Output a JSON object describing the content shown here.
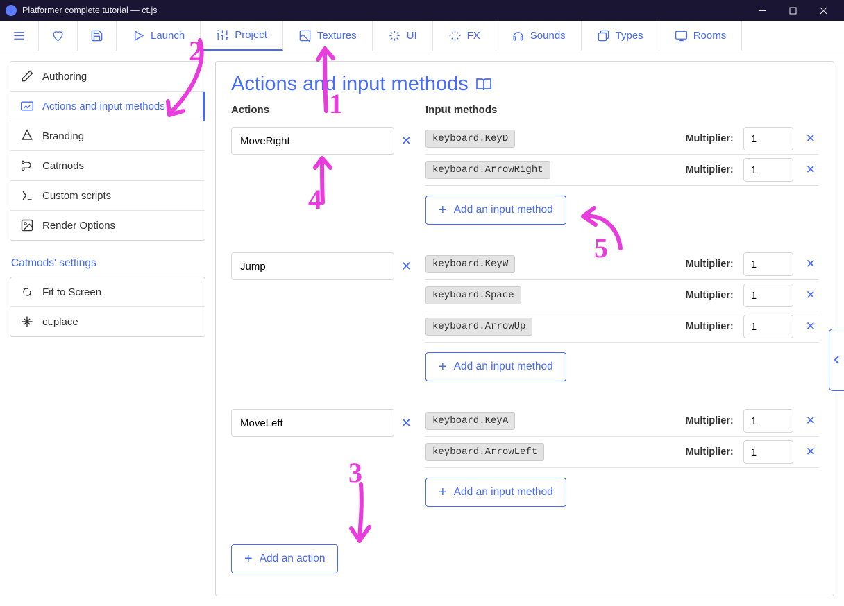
{
  "window": {
    "title": "Platformer complete tutorial — ct.js"
  },
  "toolbar": {
    "launch": "Launch",
    "project": "Project",
    "textures": "Textures",
    "ui": "UI",
    "fx": "FX",
    "sounds": "Sounds",
    "types": "Types",
    "rooms": "Rooms"
  },
  "sidebar": {
    "items": [
      {
        "label": "Authoring"
      },
      {
        "label": "Actions and input methods"
      },
      {
        "label": "Branding"
      },
      {
        "label": "Catmods"
      },
      {
        "label": "Custom scripts"
      },
      {
        "label": "Render Options"
      }
    ],
    "catmods_heading": "Catmods' settings",
    "catmods_items": [
      {
        "label": "Fit to Screen"
      },
      {
        "label": "ct.place"
      }
    ]
  },
  "panel": {
    "heading": "Actions and input methods",
    "col_actions": "Actions",
    "col_inputs": "Input methods",
    "multiplier_label": "Multiplier:",
    "add_input_label": "Add an input method",
    "add_action_label": "Add an action",
    "actions": [
      {
        "name": "MoveRight",
        "inputs": [
          {
            "code": "keyboard.KeyD",
            "mult": "1"
          },
          {
            "code": "keyboard.ArrowRight",
            "mult": "1"
          }
        ]
      },
      {
        "name": "Jump",
        "inputs": [
          {
            "code": "keyboard.KeyW",
            "mult": "1"
          },
          {
            "code": "keyboard.Space",
            "mult": "1"
          },
          {
            "code": "keyboard.ArrowUp",
            "mult": "1"
          }
        ]
      },
      {
        "name": "MoveLeft",
        "inputs": [
          {
            "code": "keyboard.KeyA",
            "mult": "1"
          },
          {
            "code": "keyboard.ArrowLeft",
            "mult": "1"
          }
        ]
      }
    ]
  },
  "annotations": {
    "n1": "1",
    "n2": "2",
    "n3": "3",
    "n4": "4",
    "n5": "5"
  }
}
